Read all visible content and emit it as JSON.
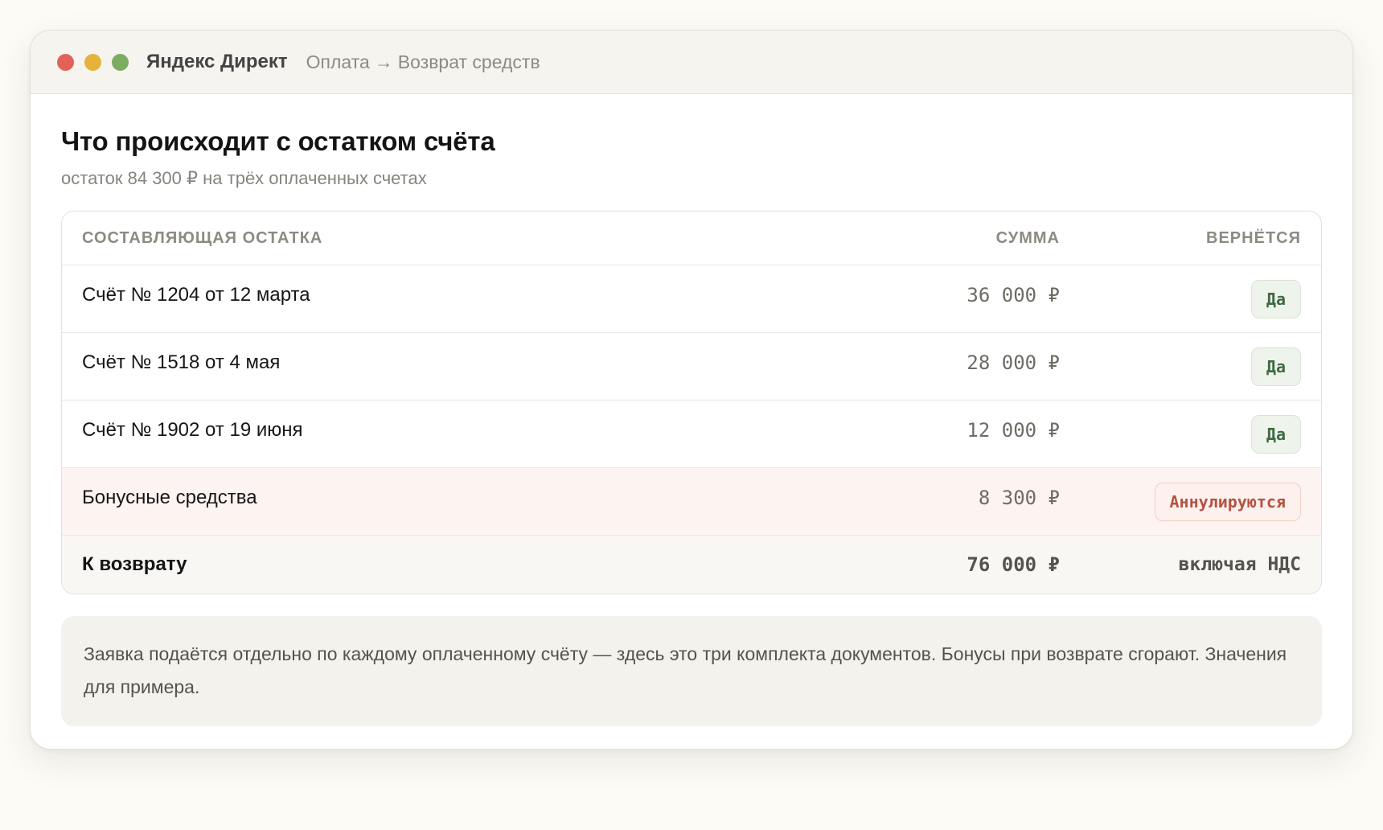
{
  "window": {
    "app_title": "Яндекс Директ",
    "breadcrumb": {
      "parent": "Оплата",
      "arrow": "→",
      "current": "Возврат средств"
    }
  },
  "page": {
    "title": "Что происходит с остатком счёта",
    "subtitle": "остаток 84 300 ₽ на трёх оплаченных счетах"
  },
  "table": {
    "headers": {
      "component": "Составляющая остатка",
      "amount": "Сумма",
      "refund": "Вернётся"
    },
    "rows": [
      {
        "name": "Счёт № 1204 от 12 марта",
        "amount": "36 000 ₽",
        "status": "Да"
      },
      {
        "name": "Счёт № 1518 от 4 мая",
        "amount": "28 000 ₽",
        "status": "Да"
      },
      {
        "name": "Счёт № 1902 от 19 июня",
        "amount": "12 000 ₽",
        "status": "Да"
      },
      {
        "name": "Бонусные средства",
        "amount": "8 300 ₽",
        "status": "Аннулируются"
      }
    ],
    "total": {
      "label": "К возврату",
      "amount": "76 000 ₽",
      "note": "включая НДС"
    }
  },
  "note": {
    "text": "Заявка подаётся отдельно по каждому оплаченному счёту — здесь это три комплекта документов. Бонусы при возврате сгорают. Значения для примера."
  },
  "colors": {
    "yes_badge": "#3e6a42",
    "cancel_badge": "#b65240",
    "bonus_row_bg": "#fdf3f1"
  }
}
